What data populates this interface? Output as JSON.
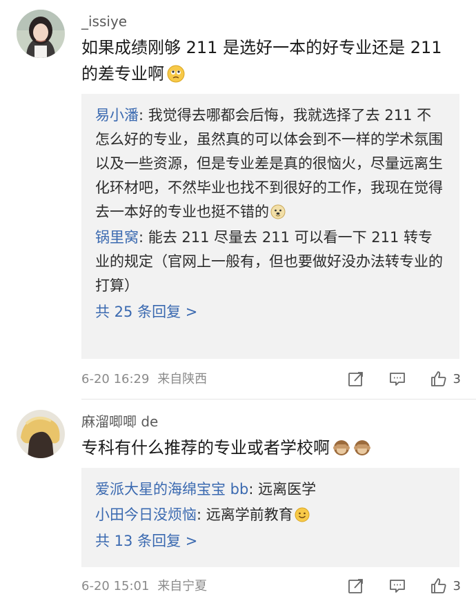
{
  "comments": [
    {
      "username": "_issiye",
      "content": "如果成绩刚够 211 是选好一本的好专业还是 211 的差专业啊",
      "content_emoji": "worried-face",
      "replies": [
        {
          "name": "易小潘",
          "text": ": 我觉得去哪都会后悔，我就选择了去 211 不怎么好的专业，虽然真的可以体会到不一样的学术氛围以及一些资源，但是专业差是真的很恼火，尽量远离生化环材吧，不然毕业也找不到很好的工作，我现在觉得去一本好的专业也挺不错的",
          "emoji": "doge"
        },
        {
          "name": "锅里窝",
          "text": ": 能去 211 尽量去 211 可以看一下 211 转专业的规定（官网上一般有，但也要做好没办法转专业的打算）"
        }
      ],
      "more": "共 25 条回复 >",
      "time": "6-20 16:29",
      "location": "来自陕西",
      "likes": "3"
    },
    {
      "username": "麻溜唧唧 de",
      "content": "专科有什么推荐的专业或者学校啊",
      "content_emoji": "see-no-evil-monkey",
      "replies": [
        {
          "name": "爱派大星的海绵宝宝 bb",
          "text": ": 远离医学"
        },
        {
          "name": "小田今日没烦恼",
          "text": ": 远离学前教育",
          "emoji": "smile"
        }
      ],
      "more": "共 13 条回复 >",
      "time": "6-20 15:01",
      "location": "来自宁夏",
      "likes": "3"
    }
  ],
  "colors": {
    "link": "#3a69b0",
    "meta": "#8a8a8a",
    "reply_bg": "#f2f2f2"
  },
  "icons": [
    "share-icon",
    "comment-icon",
    "like-icon"
  ]
}
